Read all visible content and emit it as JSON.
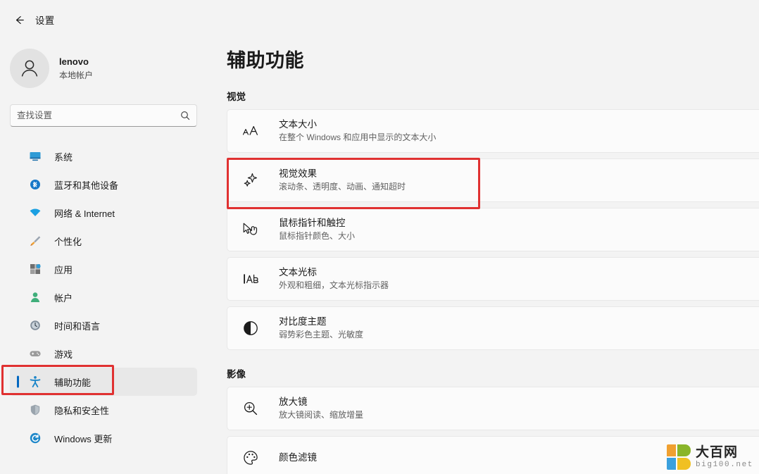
{
  "titlebar": {
    "back_icon": "arrow-left-icon",
    "title": "设置"
  },
  "sidebar": {
    "account": {
      "avatar_icon": "person-icon",
      "name": "lenovo",
      "type": "本地帐户"
    },
    "search": {
      "placeholder": "查找设置",
      "value": "",
      "icon": "search-icon"
    },
    "items": [
      {
        "label": "系统",
        "icon": "system-monitor-icon",
        "selected": false
      },
      {
        "label": "蓝牙和其他设备",
        "icon": "bluetooth-icon",
        "selected": false
      },
      {
        "label": "网络 & Internet",
        "icon": "wifi-icon",
        "selected": false
      },
      {
        "label": "个性化",
        "icon": "paintbrush-icon",
        "selected": false
      },
      {
        "label": "应用",
        "icon": "apps-grid-icon",
        "selected": false
      },
      {
        "label": "帐户",
        "icon": "account-person-icon",
        "selected": false
      },
      {
        "label": "时间和语言",
        "icon": "clock-globe-icon",
        "selected": false
      },
      {
        "label": "游戏",
        "icon": "gamepad-icon",
        "selected": false
      },
      {
        "label": "辅助功能",
        "icon": "accessibility-icon",
        "selected": true
      },
      {
        "label": "隐私和安全性",
        "icon": "shield-icon",
        "selected": false
      },
      {
        "label": "Windows 更新",
        "icon": "update-refresh-icon",
        "selected": false
      }
    ]
  },
  "main": {
    "page_title": "辅助功能",
    "sections": [
      {
        "heading": "视觉",
        "cards": [
          {
            "title": "文本大小",
            "subtitle": "在整个 Windows 和应用中显示的文本大小",
            "icon": "text-size-aa-icon",
            "highlighted": false
          },
          {
            "title": "视觉效果",
            "subtitle": "滚动条、透明度、动画、通知超时",
            "icon": "sparkle-icon",
            "highlighted": true
          },
          {
            "title": "鼠标指针和触控",
            "subtitle": "鼠标指针颜色、大小",
            "icon": "mouse-pointer-touch-icon",
            "highlighted": false
          },
          {
            "title": "文本光标",
            "subtitle": "外观和粗细，文本光标指示器",
            "icon": "text-cursor-ab-icon",
            "highlighted": false
          },
          {
            "title": "对比度主题",
            "subtitle": "弱势彩色主题、光敏度",
            "icon": "contrast-half-circle-icon",
            "highlighted": false
          }
        ]
      },
      {
        "heading": "影像",
        "cards": [
          {
            "title": "放大镜",
            "subtitle": "放大镜阅读、缩放增量",
            "icon": "magnifier-plus-icon",
            "highlighted": false
          },
          {
            "title": "颜色滤镜",
            "subtitle": "",
            "icon": "color-filter-palette-icon",
            "highlighted": false
          }
        ]
      }
    ]
  },
  "annotations": {
    "color": "#e03131",
    "sidebar_target": "辅助功能",
    "card_target": "视觉效果"
  },
  "watermark": {
    "cn": "大百网",
    "en": "big100.net"
  },
  "theme": {
    "accent": "#0067c0",
    "page_bg": "#f3f3f3",
    "card_bg": "#fbfbfb",
    "selected_bg": "#e8e8e8"
  }
}
